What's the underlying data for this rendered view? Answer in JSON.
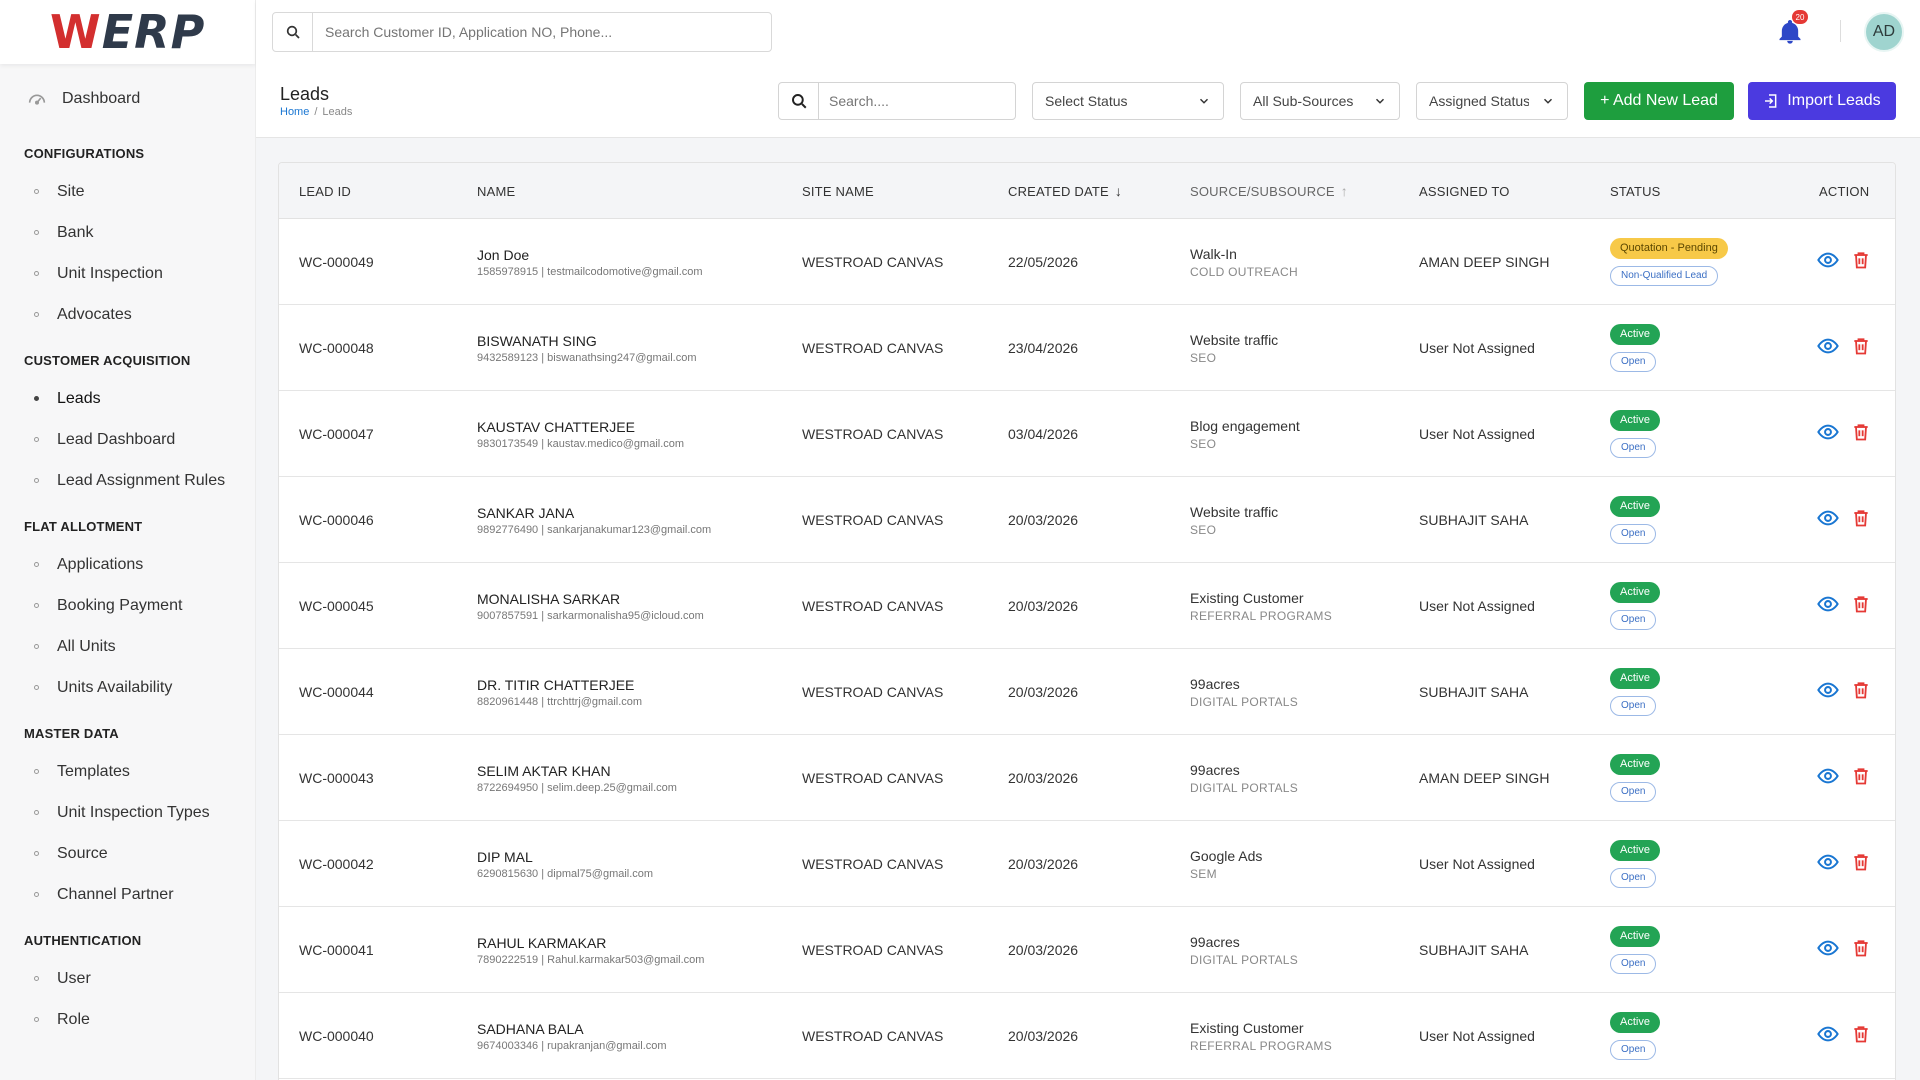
{
  "app": {
    "logo_w": "W",
    "logo_rest": "ERP"
  },
  "colors": {
    "brand_red": "#d32f2f",
    "add_button": "#1e9e3e",
    "import_button": "#4b3ae0",
    "active_status": "#23a455",
    "pending_status": "#f7c948",
    "icon_blue": "#1976d2",
    "delete_red": "#e53935"
  },
  "topbar": {
    "search_placeholder": "Search Customer ID, Application NO, Phone...",
    "notification_count": "20",
    "avatar_initials": "AD"
  },
  "sidebar": {
    "dashboard": "Dashboard",
    "sections": [
      {
        "title": "CONFIGURATIONS",
        "items": [
          "Site",
          "Bank",
          "Unit Inspection",
          "Advocates"
        ]
      },
      {
        "title": "CUSTOMER ACQUISITION",
        "items": [
          "Leads",
          "Lead Dashboard",
          "Lead Assignment Rules"
        ]
      },
      {
        "title": "FLAT ALLOTMENT",
        "items": [
          "Applications",
          "Booking Payment",
          "All Units",
          "Units Availability"
        ]
      },
      {
        "title": "MASTER DATA",
        "items": [
          "Templates",
          "Unit Inspection Types",
          "Source",
          "Channel Partner"
        ]
      },
      {
        "title": "AUTHENTICATION",
        "items": [
          "User",
          "Role"
        ]
      }
    ],
    "active_item": "Leads"
  },
  "page": {
    "title": "Leads",
    "breadcrumb_home": "Home",
    "breadcrumb_sep": "/",
    "breadcrumb_current": "Leads",
    "search_placeholder": "Search....",
    "status_filter": "Select Status",
    "subsource_filter": "All Sub-Sources",
    "assigned_filter": "Assigned Status",
    "add_button": "+ Add New Lead",
    "import_button": "Import Leads"
  },
  "table": {
    "headers": {
      "lead_id": "LEAD ID",
      "name": "NAME",
      "site": "SITE NAME",
      "created": "CREATED DATE",
      "source": "SOURCE/SUBSOURCE",
      "assigned": "ASSIGNED TO",
      "status": "STATUS",
      "action": "ACTION"
    },
    "rows": [
      {
        "id": "WC-000049",
        "name": "Jon Doe",
        "contact": "1585978915 | testmailcodomotive@gmail.com",
        "site": "WESTROAD CANVAS",
        "date": "22/05/2026",
        "source": "Walk-In",
        "subsource": "COLD OUTREACH",
        "assigned": "AMAN DEEP SINGH",
        "status": "Quotation - Pending",
        "status_type": "pending",
        "tag": "Non-Qualified Lead"
      },
      {
        "id": "WC-000048",
        "name": "BISWANATH SING",
        "contact": "9432589123 | biswanathsing247@gmail.com",
        "site": "WESTROAD CANVAS",
        "date": "23/04/2026",
        "source": "Website traffic",
        "subsource": "SEO",
        "assigned": "User Not Assigned",
        "status": "Active",
        "status_type": "active",
        "tag": "Open"
      },
      {
        "id": "WC-000047",
        "name": "KAUSTAV CHATTERJEE",
        "contact": "9830173549 | kaustav.medico@gmail.com",
        "site": "WESTROAD CANVAS",
        "date": "03/04/2026",
        "source": "Blog engagement",
        "subsource": "SEO",
        "assigned": "User Not Assigned",
        "status": "Active",
        "status_type": "active",
        "tag": "Open"
      },
      {
        "id": "WC-000046",
        "name": "SANKAR JANA",
        "contact": "9892776490 | sankarjanakumar123@gmail.com",
        "site": "WESTROAD CANVAS",
        "date": "20/03/2026",
        "source": "Website traffic",
        "subsource": "SEO",
        "assigned": "SUBHAJIT SAHA",
        "status": "Active",
        "status_type": "active",
        "tag": "Open"
      },
      {
        "id": "WC-000045",
        "name": "MONALISHA SARKAR",
        "contact": "9007857591 | sarkarmonalisha95@icloud.com",
        "site": "WESTROAD CANVAS",
        "date": "20/03/2026",
        "source": "Existing Customer",
        "subsource": "REFERRAL PROGRAMS",
        "assigned": "User Not Assigned",
        "status": "Active",
        "status_type": "active",
        "tag": "Open"
      },
      {
        "id": "WC-000044",
        "name": "DR. TITIR CHATTERJEE",
        "contact": "8820961448 | ttrchttrj@gmail.com",
        "site": "WESTROAD CANVAS",
        "date": "20/03/2026",
        "source": "99acres",
        "subsource": "DIGITAL PORTALS",
        "assigned": "SUBHAJIT SAHA",
        "status": "Active",
        "status_type": "active",
        "tag": "Open"
      },
      {
        "id": "WC-000043",
        "name": "SELIM AKTAR KHAN",
        "contact": "8722694950 | selim.deep.25@gmail.com",
        "site": "WESTROAD CANVAS",
        "date": "20/03/2026",
        "source": "99acres",
        "subsource": "DIGITAL PORTALS",
        "assigned": "AMAN DEEP SINGH",
        "status": "Active",
        "status_type": "active",
        "tag": "Open"
      },
      {
        "id": "WC-000042",
        "name": "DIP MAL",
        "contact": "6290815630 | dipmal75@gmail.com",
        "site": "WESTROAD CANVAS",
        "date": "20/03/2026",
        "source": "Google Ads",
        "subsource": "SEM",
        "assigned": "User Not Assigned",
        "status": "Active",
        "status_type": "active",
        "tag": "Open"
      },
      {
        "id": "WC-000041",
        "name": "RAHUL KARMAKAR",
        "contact": "7890222519 | Rahul.karmakar503@gmail.com",
        "site": "WESTROAD CANVAS",
        "date": "20/03/2026",
        "source": "99acres",
        "subsource": "DIGITAL PORTALS",
        "assigned": "SUBHAJIT SAHA",
        "status": "Active",
        "status_type": "active",
        "tag": "Open"
      },
      {
        "id": "WC-000040",
        "name": "SADHANA BALA",
        "contact": "9674003346 | rupakranjan@gmail.com",
        "site": "WESTROAD CANVAS",
        "date": "20/03/2026",
        "source": "Existing Customer",
        "subsource": "REFERRAL PROGRAMS",
        "assigned": "User Not Assigned",
        "status": "Active",
        "status_type": "active",
        "tag": "Open"
      }
    ]
  }
}
